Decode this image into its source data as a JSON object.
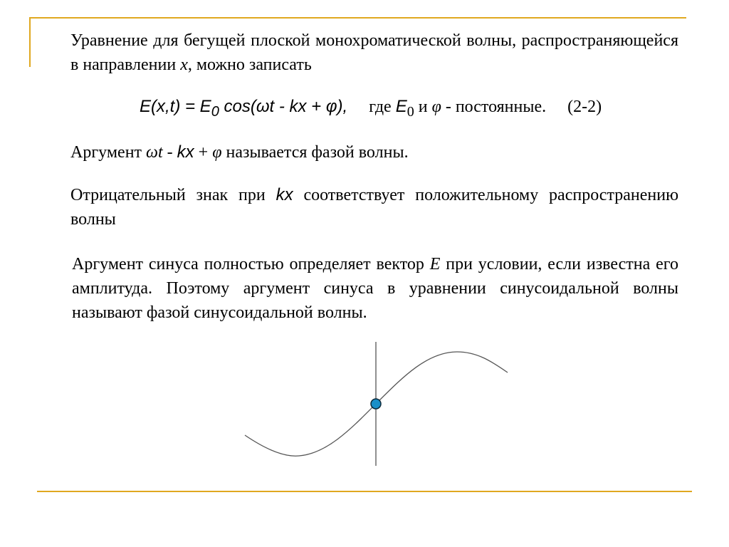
{
  "slide": {
    "p1": {
      "text_before": "Уравнение для бегущей плоской монохроматической волны, распространяющейся в направлении ",
      "var": "x",
      "text_after": ", можно записать"
    },
    "formula": {
      "lhs": "E(x,t) = E",
      "sub0": "0",
      "rhs": " cos(ωt - kx + φ),",
      "where": "где ",
      "E": "E",
      "E_sub": "0",
      "and": " и ",
      "phi": "φ",
      "const": " - постоянные.",
      "number": "(2-2)"
    },
    "p2": {
      "text_before": "Аргумент ",
      "omega_t": "ωt",
      "minus": " - ",
      "kx": "kx",
      "plus": " + ",
      "phi": "φ",
      "text_after": " называется фазой волны."
    },
    "p3": {
      "text_before": "Отрицательный знак при ",
      "kx": "kx",
      "text_after": " соответствует положительному распространению волны"
    },
    "p4": {
      "text_before": "Аргумент синуса полностью определяет вектор ",
      "E": "E",
      "text_after": " при условии, если известна его амплитуда. Поэтому аргумент синуса в уравнении синусоидальной волны называют фазой синусоидальной волны."
    }
  },
  "colors": {
    "accent_rule": "#e0a820",
    "dot_fill": "#1a8fc8",
    "curve": "#555555"
  }
}
